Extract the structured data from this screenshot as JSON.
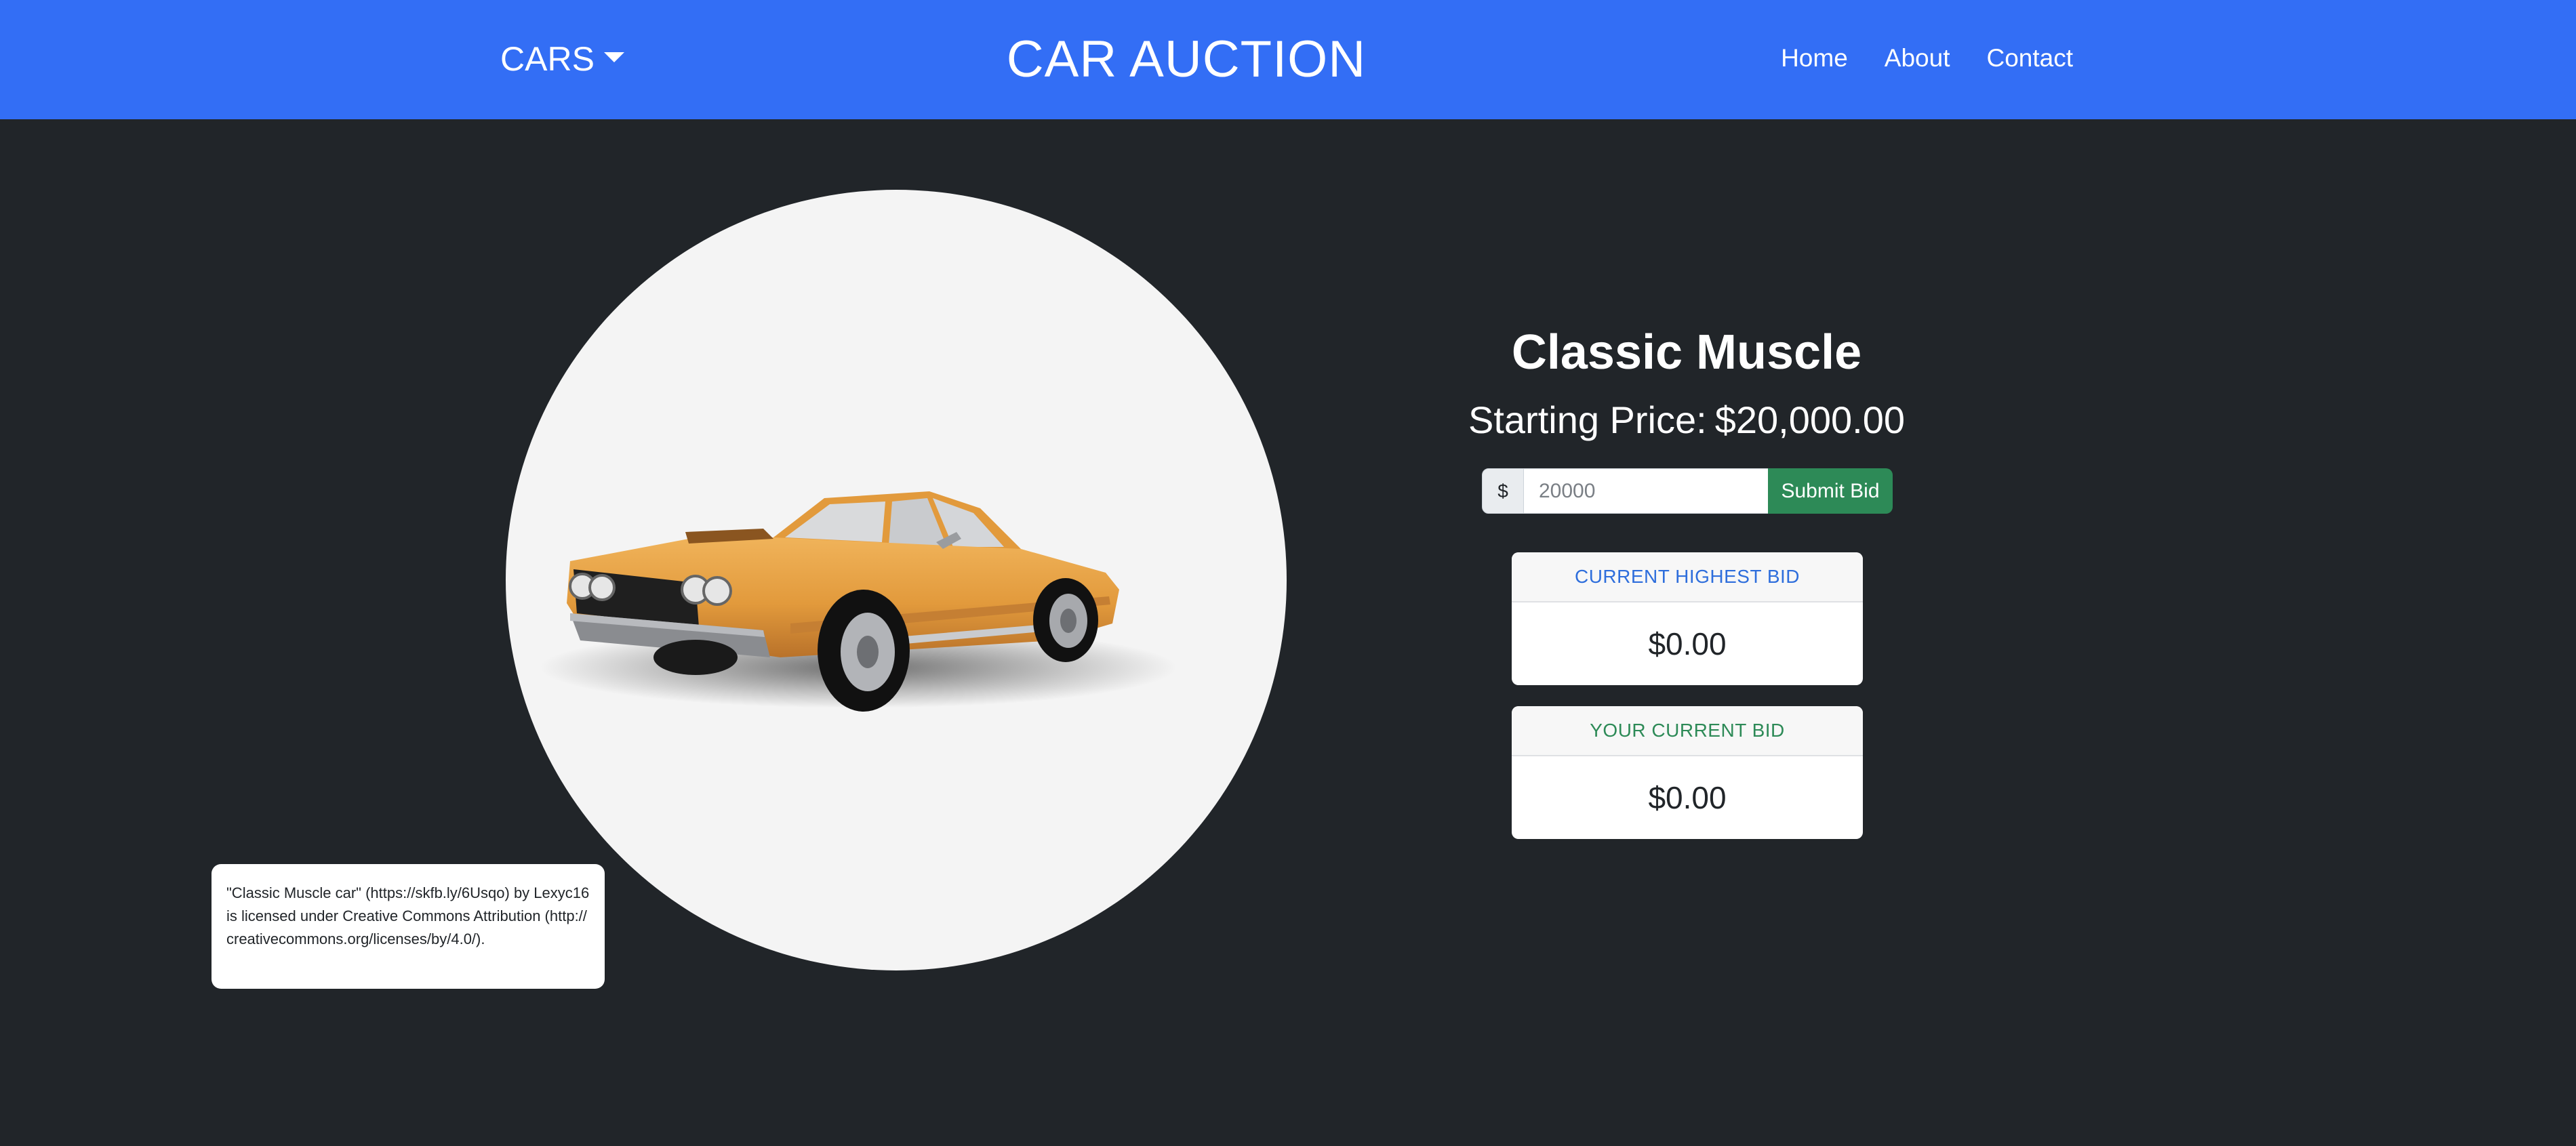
{
  "navbar": {
    "dropdown_label": "CARS",
    "title": "CAR AUCTION",
    "links": [
      {
        "label": "Home"
      },
      {
        "label": "About"
      },
      {
        "label": "Contact"
      }
    ]
  },
  "car": {
    "name": "Classic Muscle",
    "starting_price_label": "Starting Price:",
    "starting_price_value": "$20,000.00",
    "body_color": "#e29a3c",
    "attribution": "\"Classic Muscle car\" (https://skfb.ly/6Usqo) by Lexyc16 is licensed under Creative Commons Attribution (http://creativecommons.org/licenses/by/4.0/)."
  },
  "bid_form": {
    "currency_prefix": "$",
    "input_placeholder": "20000",
    "submit_label": "Submit Bid"
  },
  "cards": {
    "highest": {
      "title": "CURRENT HIGHEST BID",
      "value": "$0.00"
    },
    "yours": {
      "title": "YOUR CURRENT BID",
      "value": "$0.00"
    }
  },
  "colors": {
    "navbar": "#336ef5",
    "background": "#212529",
    "submit": "#2d8a57",
    "highest_title": "#2e6edc",
    "yours_title": "#2d8a57"
  }
}
